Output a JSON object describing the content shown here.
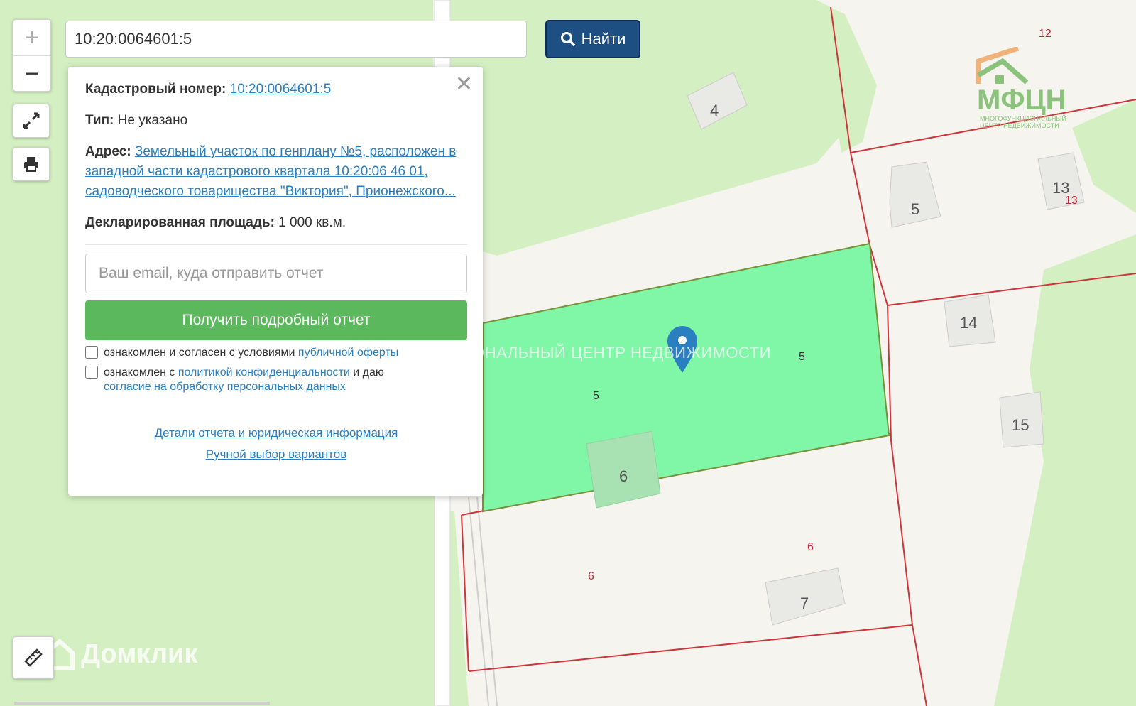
{
  "search": {
    "value": "10:20:0064601:5",
    "button_label": "Найти"
  },
  "controls": {
    "zoom_in": "+",
    "zoom_out": "−"
  },
  "popup": {
    "cadastral_label": "Кадастровый номер:",
    "cadastral_value": "10:20:0064601:5",
    "type_label": "Тип:",
    "type_value": "Не указано",
    "address_label": "Адрес:",
    "address_value": "Земельный участок по генплану №5, расположен в западной части кадастрового квартала 10:20:06 46 01, садоводческого товарищества \"Виктория\", Прионежского...",
    "area_label": "Декларированная площадь:",
    "area_value": "1 000 кв.м.",
    "email_placeholder": "Ваш email, куда отправить отчет",
    "report_button": "Получить подробный отчет",
    "consent1_text": "ознакомлен и согласен с условиями",
    "consent1_link": "публичной оферты",
    "consent2_text": "ознакомлен с",
    "consent2_link": "политикой конфиденциальности",
    "consent2_text2": "и даю",
    "consent2_link2": "согласие на обработку персональных данных",
    "details_link": "Детали отчета и юридическая информация",
    "manual_link": "Ручной выбор вариантов"
  },
  "map": {
    "watermark": "МНОГОФУНКЦИОНАЛЬНЫЙ ЦЕНТР НЕДВИЖИМОСТИ",
    "building_labels": [
      "4",
      "5",
      "13",
      "14",
      "15",
      "6",
      "7"
    ],
    "parcel_labels": [
      "12",
      "13",
      "5",
      "5",
      "6",
      "6"
    ],
    "colors": {
      "parcel_highlight": "#80f7a6",
      "parcel_border": "#d0343a",
      "green_area": "#d4f0c2",
      "road": "#f5f4ee",
      "marker": "#2a7fc1"
    }
  },
  "branding": {
    "domklik": "Домклик",
    "logo_name": "МФЦН",
    "logo_sub1": "МНОГОФУНКЦИОНАЛЬНЫЙ",
    "logo_sub2": "ЦЕНТР НЕДВИЖИМОСТИ"
  }
}
